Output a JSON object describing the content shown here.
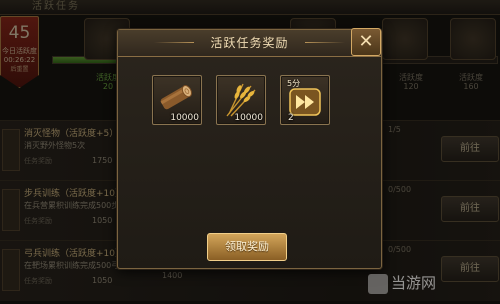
{
  "header": {
    "title": "活跃任务"
  },
  "activity": {
    "points": "45",
    "label": "今日活跃度",
    "countdown": "00:26:22",
    "hint": "后重置"
  },
  "progress": {
    "fraction": 0.3
  },
  "milestones": [
    {
      "label": "活跃度",
      "value": "20",
      "status": "done"
    },
    {
      "label": "活跃度",
      "value": "120",
      "status": "locked"
    },
    {
      "label": "活跃度",
      "value": "160",
      "status": "locked"
    }
  ],
  "tasks": [
    {
      "name": "消灭怪物（活跃度+5）",
      "desc": "消灭野外怪物5次",
      "reward_label": "任务奖励",
      "reward": "1750",
      "progress": "1/5",
      "button": "前往"
    },
    {
      "name": "步兵训练（活跃度+10）",
      "desc": "在兵营累积训练完成500步兵",
      "reward_label": "任务奖励",
      "reward": "1050",
      "progress": "0/500",
      "button": "前往"
    },
    {
      "name": "弓兵训练（活跃度+10）",
      "desc": "在靶场累积训练完成500弓兵",
      "reward_label": "任务奖励",
      "reward": "1050",
      "progress": "0/500",
      "button": "前往"
    },
    {
      "name": "",
      "desc": "",
      "reward_label": "",
      "reward": "1400",
      "progress": "",
      "button": ""
    }
  ],
  "popup": {
    "title": "活跃任务奖励",
    "close_icon": "close-icon",
    "rewards": [
      {
        "icon": "wood-icon",
        "quantity": "10000"
      },
      {
        "icon": "wheat-icon",
        "quantity": "10000"
      },
      {
        "icon": "speedup-icon",
        "quantity": "2",
        "tag": "5分"
      }
    ],
    "claim_label": "领取奖励"
  },
  "watermark": {
    "text": "当游网",
    "badge": "3HE"
  },
  "colors": {
    "accent_gold": "#d3a55a",
    "progress_green": "#6fae3c",
    "badge_red": "#9a2c1c"
  }
}
